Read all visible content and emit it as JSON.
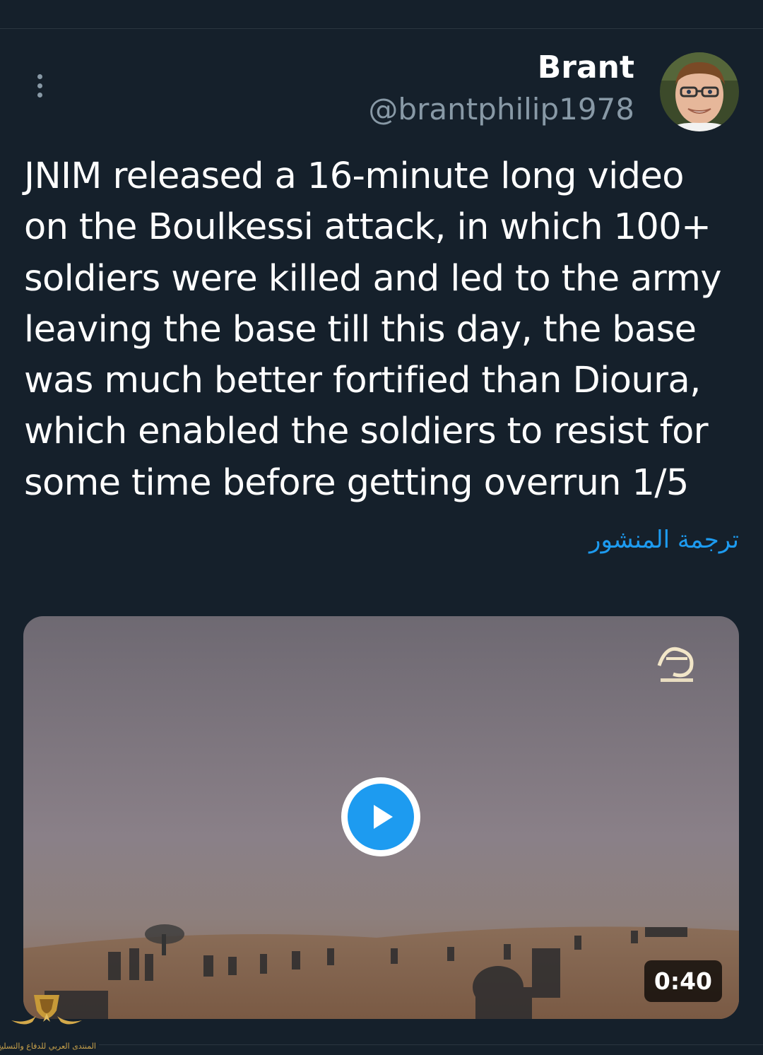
{
  "author": {
    "display_name": "Brant",
    "handle": "@brantphilip1978",
    "avatar_icon": "profile-photo"
  },
  "tweet": {
    "text": "JNIM released a 16-minute long video on the Boulkessi attack, in which 100+ soldiers were killed and led to the army leaving the base till this day, the base was much better fortified than Dioura, which enabled the soldiers to resist for some time before getting overrun 1/5",
    "translate_label": "ترجمة المنشور"
  },
  "media": {
    "type": "video",
    "duration": "0:40",
    "play_icon": "play-icon",
    "channel_logo_icon": "channel-logo-icon"
  },
  "watermark": {
    "icon": "forum-emblem-icon",
    "text": "المنتدى العربي للدفاع والتسليح"
  },
  "colors": {
    "background": "#15202b",
    "accent": "#1d9bf0",
    "secondary_text": "#8899a6",
    "primary_text": "#ffffff"
  }
}
